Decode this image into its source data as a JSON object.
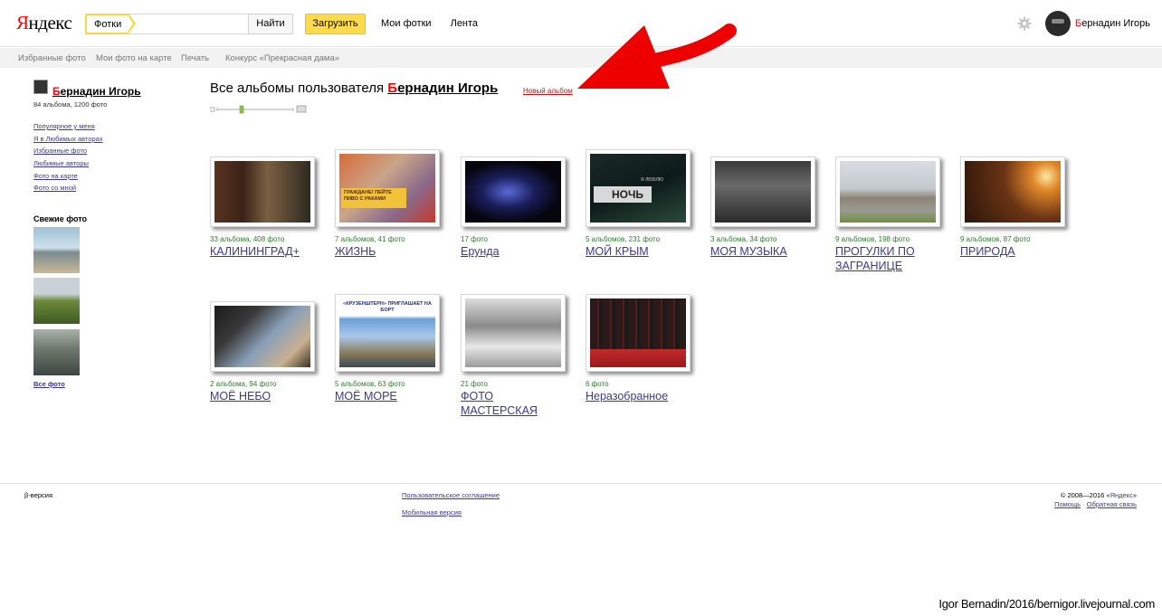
{
  "header": {
    "logo_first": "Я",
    "logo_rest": "ндекс",
    "search_tag": "Фотки",
    "search_value": "",
    "search_button": "Найти",
    "upload_button": "Загрузить",
    "nav": [
      "Мои фотки",
      "Лента"
    ],
    "user_first": "Б",
    "user_rest": "ернадин Игорь"
  },
  "subnav": [
    "Избранные фото",
    "Мои фото на карте",
    "Печать",
    "Конкурс «Прекрасная дама»"
  ],
  "sidebar": {
    "user_first": "Б",
    "user_rest": "ернадин Игорь",
    "stats": "84 альбома, 1200 фото",
    "links": [
      "Популярное у меня",
      "Я в Любимых авторах",
      "Избранные фото",
      "Любимые авторы",
      "Фото на карте",
      "Фото со мной"
    ],
    "fresh_title": "Свежие фото",
    "all_photos": "Все фото"
  },
  "main": {
    "title_prefix": "Все альбомы пользователя",
    "owner_first": "Б",
    "owner_rest": "ернадин Игорь",
    "new_album": "Новый альбом"
  },
  "albums": [
    {
      "count": "33 альбома, 408 фото",
      "title": "КАЛИНИНГРАД+"
    },
    {
      "count": "7 альбомов, 41 фото",
      "title": "ЖИЗНЬ"
    },
    {
      "count": "17 фото",
      "title": "Ерунда"
    },
    {
      "count": "5 альбомов, 231 фото",
      "title": "МОЙ КРЫМ"
    },
    {
      "count": "3 альбома, 34 фото",
      "title": "МОЯ МУЗЫКА"
    },
    {
      "count": "9 альбомов, 198 фото",
      "title": "ПРОГУЛКИ ПО ЗАГРАНИЦЕ"
    },
    {
      "count": "9 альбомов, 87 фото",
      "title": "ПРИРОДА"
    },
    {
      "count": "2 альбома, 94 фото",
      "title": "МОЁ НЕБО"
    },
    {
      "count": "5 альбомов, 63 фото",
      "title": "МОЁ МОРЕ"
    },
    {
      "count": "21 фото",
      "title": "ФОТО МАСТЕРСКАЯ"
    },
    {
      "count": "6 фото",
      "title": "Неразобранное"
    }
  ],
  "album_image_text": {
    "zhizn": "ГРАЖДАНЕ! ПЕЙТЕ ПИВО С РАКАМИ",
    "krym": "НОЧЬ",
    "krym_small": "Я ЛЮБЛЮ",
    "more": "«КРУЗЕНШТЕРН» ПРИГЛАШАЕТ НА БОРТ"
  },
  "footer": {
    "beta": "β-версия",
    "terms": "Пользовательское соглашение",
    "mobile": "Мобильная версия",
    "copyright_prefix": "© 2008—2016 «",
    "copyright_link": "Яндекс",
    "copyright_suffix": "»",
    "help": "Помощь",
    "separator": "·",
    "feedback": "Обратная связь"
  },
  "watermark": "Igor Bernadin/2016/bernigor.livejournal.com",
  "colors": {
    "accent_yellow": "#fedb4d",
    "brand_red": "#ff0000",
    "link": "#3a3a8c",
    "count_green": "#2f7a2f",
    "arrow_red": "#ee0000"
  }
}
